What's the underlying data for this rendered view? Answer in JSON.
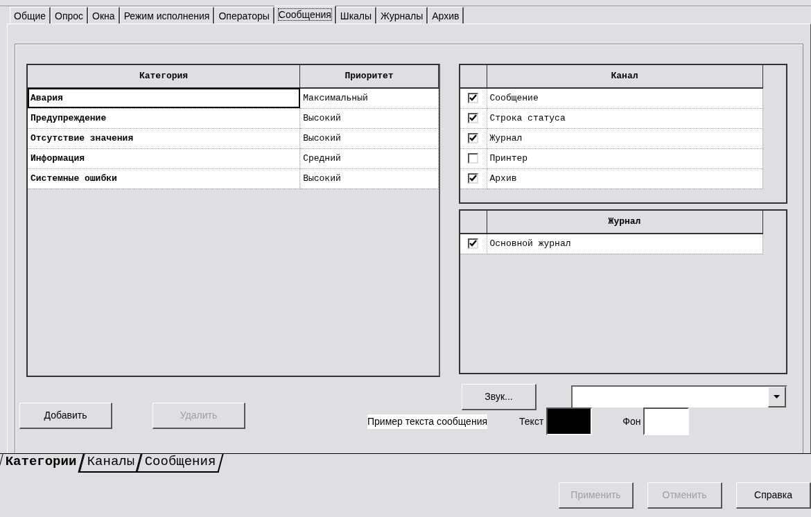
{
  "tabs": [
    {
      "label": "Общие",
      "selected": false
    },
    {
      "label": "Опрос",
      "selected": false
    },
    {
      "label": "Окна",
      "selected": false
    },
    {
      "label": "Режим исполнения",
      "selected": false
    },
    {
      "label": "Операторы",
      "selected": false
    },
    {
      "label": "Сообщения",
      "selected": true
    },
    {
      "label": "Шкалы",
      "selected": false
    },
    {
      "label": "Журналы",
      "selected": false
    },
    {
      "label": "Архив",
      "selected": false
    }
  ],
  "categories": {
    "columns": [
      "Категория",
      "Приоритет"
    ],
    "rows": [
      {
        "category": "Авария",
        "priority": "Максимальный",
        "selected": true
      },
      {
        "category": "Предупреждение",
        "priority": "Высокий",
        "selected": false
      },
      {
        "category": "Отсутствие значения",
        "priority": "Высокий",
        "selected": false
      },
      {
        "category": "Информация",
        "priority": "Средний",
        "selected": false
      },
      {
        "category": "Системные ошибки",
        "priority": "Высокий",
        "selected": false
      }
    ]
  },
  "channels": {
    "column": "Канал",
    "items": [
      {
        "label": "Сообщение",
        "checked": true
      },
      {
        "label": "Строка статуса",
        "checked": true
      },
      {
        "label": "Журнал",
        "checked": true
      },
      {
        "label": "Принтер",
        "checked": false
      },
      {
        "label": "Архив",
        "checked": true
      }
    ]
  },
  "journals": {
    "column": "Журнал",
    "items": [
      {
        "label": "Основной журнал",
        "checked": true
      }
    ]
  },
  "sound_button": {
    "label": "Звук...",
    "disabled": false
  },
  "buttons": [
    {
      "label": "Добавить",
      "disabled": false
    },
    {
      "label": "Удалить",
      "disabled": true
    }
  ],
  "sample_text": "Пример текста сообщения",
  "text_color": {
    "label": "Текст",
    "color": "#000000"
  },
  "background_color": {
    "label": "Фон",
    "color": "#ffffff"
  },
  "sheet_tabs": [
    {
      "label": "Категории",
      "selected": true
    },
    {
      "label": "Каналы",
      "selected": false
    },
    {
      "label": "Сообщения",
      "selected": false
    }
  ],
  "footer_buttons": [
    {
      "label": "Применить",
      "disabled": true
    },
    {
      "label": "Отменить",
      "disabled": true
    },
    {
      "label": "Справка",
      "disabled": false
    }
  ]
}
